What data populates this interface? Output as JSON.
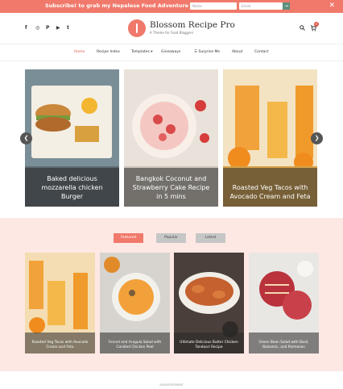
{
  "topbar": {
    "message": "Subscribe! to grab my Nepalese Food Adventure eBook!",
    "name_placeholder": "Name",
    "email_placeholder": "Email",
    "go_label": "→",
    "close_label": "✕"
  },
  "header": {
    "site_title": "Blossom Recipe Pro",
    "tagline": "A Theme for Food Bloggers",
    "cart_count": "0",
    "social": [
      "f",
      "◎",
      "P",
      "▶",
      "t"
    ]
  },
  "nav": {
    "items": [
      "Home",
      "Recipe Index",
      "Templates ▾",
      "Giveaways",
      "☰ Surprise Me",
      "About",
      "Contact"
    ]
  },
  "slider": {
    "slides": [
      {
        "caption": "Baked delicious mozzarella chicken Burger"
      },
      {
        "caption": "Bangkok Coconut and Strawberry Cake Recipe in 5 mins"
      },
      {
        "caption": "Roasted Veg Tacos with Avocado Cream and Feta"
      }
    ],
    "prev_label": "❮",
    "next_label": "❯"
  },
  "tabs": {
    "featured": "Featured",
    "popular": "Popular",
    "latest": "Latest"
  },
  "cards": [
    {
      "caption": "Roasted Veg Tacos with Avocado Cream and Feta"
    },
    {
      "caption": "Fennel and Arugula Salad with Candied Chicken Peel"
    },
    {
      "caption": "Ultimate Delicious Butter Chicken Tandoori Recipe"
    },
    {
      "caption": "Green Bean Salad with Basil, Balsamic, and Parmesan"
    }
  ],
  "footer": {
    "label": "ADVERTISEMENT"
  }
}
